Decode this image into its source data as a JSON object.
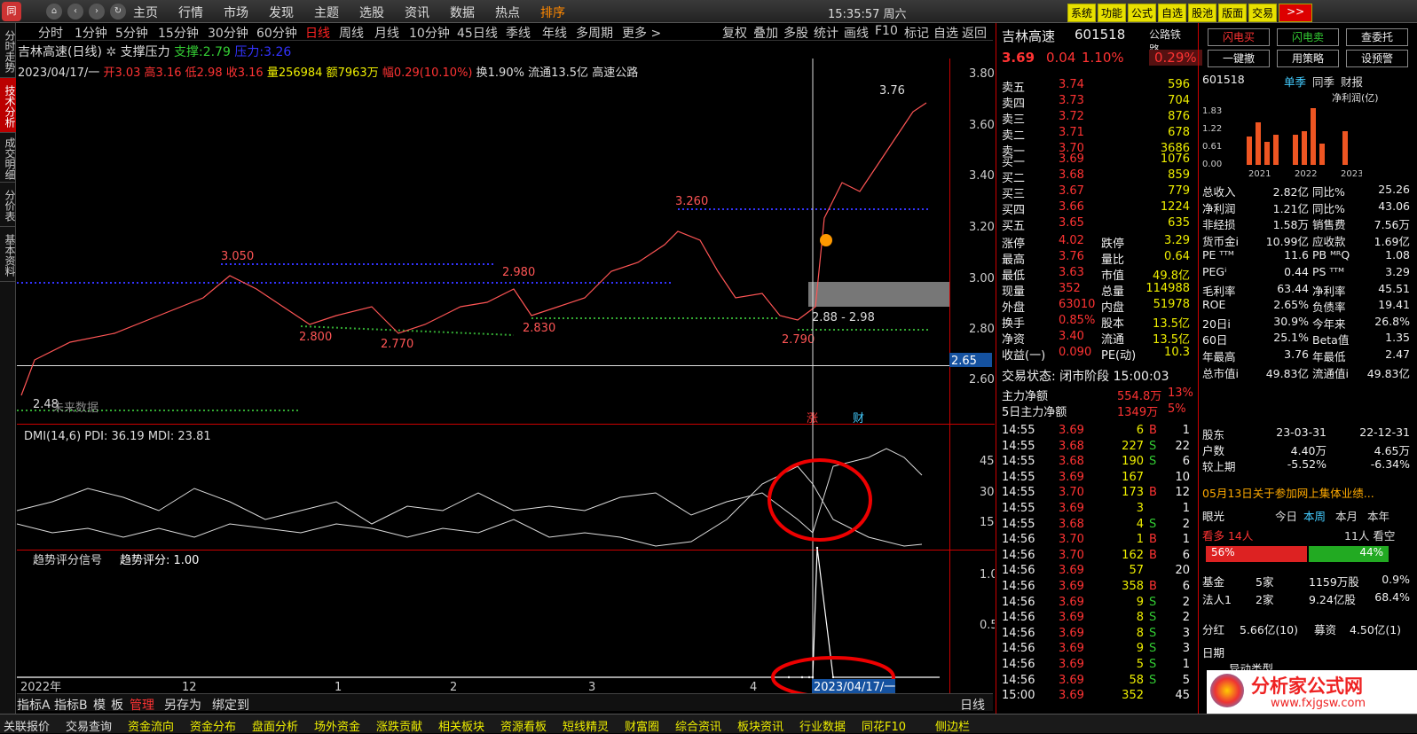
{
  "menu": {
    "items": [
      "主页",
      "行情",
      "市场",
      "发现",
      "主题",
      "选股",
      "资讯",
      "数据",
      "热点",
      "排序"
    ],
    "clock": "15:35:57 周六",
    "right_buttons": [
      "系统",
      "功能",
      "公式",
      "自选",
      "股池",
      "版面",
      "交易",
      ">>"
    ]
  },
  "left_tabs": [
    "分时走势",
    "技术分析",
    "成交明细",
    "分价表",
    "基本资料"
  ],
  "period_tabs": [
    "分时",
    "1分钟",
    "5分钟",
    "15分钟",
    "30分钟",
    "60分钟",
    "日线",
    "周线",
    "月线",
    "10分钟",
    "45日线",
    "季线",
    "年线",
    "多周期",
    "更多 >"
  ],
  "period_right": [
    "复权",
    "叠加",
    "多股",
    "统计",
    "画线",
    "F10",
    "标记",
    "自选",
    "返回"
  ],
  "chart": {
    "title": "吉林高速(日线)",
    "indicator": "支撑压力",
    "support_label": "支撑:",
    "support": "2.79",
    "pressure_label": "压力:",
    "pressure": "3.26",
    "info_date": "2023/04/17/一",
    "info_open": "开3.03",
    "info_high": "高3.16",
    "info_low": "低2.98",
    "info_close": "收3.16",
    "info_vol": "量256984",
    "info_amt": "额7963万",
    "info_chg": "幅0.29(10.10%)",
    "info_turn": "换1.90%",
    "info_float": "流通13.5亿",
    "info_ind": "高速公路",
    "price_ticks": [
      "3.80",
      "3.60",
      "3.40",
      "3.20",
      "3.00",
      "2.80",
      "2.60"
    ],
    "annotations": [
      "3.76",
      "3.260",
      "3.050",
      "2.980",
      "2.800",
      "2.770",
      "2.830",
      "2.790",
      "2.48",
      "2.88 - 2.98"
    ],
    "current_price": "2.65",
    "no_data_label": "未来数据",
    "markers": [
      "涨",
      "财"
    ],
    "dmi_title": "DMI(14,6) PDI: 36.19 MDI: 23.81",
    "dmi_ticks": [
      "45.00",
      "30.00",
      "15.00"
    ],
    "trend_title": "趋势评分信号",
    "trend_score": "趋势评分: 1.00",
    "trend_ticks": [
      "1.00",
      "0.50"
    ],
    "x_labels": [
      "2022年",
      "12",
      "1",
      "2",
      "3",
      "4"
    ],
    "cursor_date": "2023/04/17/一",
    "period_label": "日线"
  },
  "chart_data": {
    "type": "line",
    "series": [
      {
        "name": "趋势评分",
        "values": [
          0,
          0,
          0,
          0,
          1,
          0
        ]
      }
    ],
    "ylim": [
      0,
      1
    ]
  },
  "quote": {
    "name": "吉林高速",
    "code": "601518",
    "sector": "公路铁路",
    "price": "3.69",
    "chg": "0.04",
    "pct": "1.10%",
    "sector_pct": "0.29%",
    "asks": [
      [
        "卖五",
        "3.74",
        "596"
      ],
      [
        "卖四",
        "3.73",
        "704"
      ],
      [
        "卖三",
        "3.72",
        "876"
      ],
      [
        "卖二",
        "3.71",
        "678"
      ],
      [
        "卖一",
        "3.70",
        "3686"
      ]
    ],
    "bids": [
      [
        "买一",
        "3.69",
        "1076"
      ],
      [
        "买二",
        "3.68",
        "859"
      ],
      [
        "买三",
        "3.67",
        "779"
      ],
      [
        "买四",
        "3.66",
        "1224"
      ],
      [
        "买五",
        "3.65",
        "635"
      ]
    ],
    "stats": [
      [
        "涨停",
        "4.02",
        "跌停",
        "3.29"
      ],
      [
        "最高",
        "3.76",
        "量比",
        "0.64"
      ],
      [
        "最低",
        "3.63",
        "市值",
        "49.8亿"
      ],
      [
        "现量",
        "352",
        "总量",
        "114988"
      ],
      [
        "外盘",
        "63010",
        "内盘",
        "51978"
      ],
      [
        "换手",
        "0.85%",
        "股本",
        "13.5亿"
      ],
      [
        "净资",
        "3.40",
        "流通",
        "13.5亿"
      ],
      [
        "收益(一)",
        "0.090",
        "PE(动)",
        "10.3"
      ]
    ],
    "status": "交易状态: 闭市阶段 15:00:03",
    "flow": [
      [
        "主力净额",
        "554.8万",
        "13%"
      ],
      [
        "5日主力净额",
        "1349万",
        "5%"
      ]
    ],
    "ticks": [
      [
        "14:55",
        "3.69",
        "6",
        "B",
        "1"
      ],
      [
        "14:55",
        "3.68",
        "227",
        "S",
        "22"
      ],
      [
        "14:55",
        "3.68",
        "190",
        "S",
        "6"
      ],
      [
        "14:55",
        "3.69",
        "167",
        "",
        "10"
      ],
      [
        "14:55",
        "3.70",
        "173",
        "B",
        "12"
      ],
      [
        "14:55",
        "3.69",
        "3",
        "",
        "1"
      ],
      [
        "14:55",
        "3.68",
        "4",
        "S",
        "2"
      ],
      [
        "14:56",
        "3.70",
        "1",
        "B",
        "1"
      ],
      [
        "14:56",
        "3.70",
        "162",
        "B",
        "6"
      ],
      [
        "14:56",
        "3.69",
        "57",
        "",
        "20"
      ],
      [
        "14:56",
        "3.69",
        "358",
        "B",
        "6"
      ],
      [
        "14:56",
        "3.69",
        "9",
        "S",
        "2"
      ],
      [
        "14:56",
        "3.69",
        "8",
        "S",
        "2"
      ],
      [
        "14:56",
        "3.69",
        "8",
        "S",
        "3"
      ],
      [
        "14:56",
        "3.69",
        "9",
        "S",
        "3"
      ],
      [
        "14:56",
        "3.69",
        "5",
        "S",
        "1"
      ],
      [
        "14:56",
        "3.69",
        "58",
        "S",
        "5"
      ],
      [
        "15:00",
        "3.69",
        "352",
        "",
        "45"
      ]
    ]
  },
  "right": {
    "buttons": [
      "闪电买",
      "闪电卖",
      "查委托",
      "一键撤",
      "用策略",
      "设预警"
    ],
    "code": "601518",
    "tabs": [
      "单季",
      "同季",
      "财报"
    ],
    "metric": "净利润(亿)",
    "bar_ticks": [
      "1.83",
      "1.22",
      "0.61",
      "0.00"
    ],
    "years": [
      "2021",
      "2022",
      "2023"
    ],
    "fin": [
      [
        "总收入",
        "2.82亿",
        "同比%",
        "25.26"
      ],
      [
        "净利润",
        "1.21亿",
        "同比%",
        "43.06"
      ],
      [
        "非经损",
        "1.58万",
        "销售费",
        "7.56万"
      ],
      [
        "货币金i",
        "10.99亿",
        "应收款",
        "1.69亿"
      ],
      [
        "PE ᵀᵀᴹ",
        "11.6",
        "PB ᴹᴿQ",
        "1.08"
      ],
      [
        "PEGⁱ",
        "0.44",
        "PS ᵀᵀᴹ",
        "3.29"
      ],
      [
        "毛利率",
        "63.44",
        "净利率",
        "45.51"
      ],
      [
        "ROE",
        "2.65%",
        "负债率",
        "19.41"
      ],
      [
        "20日i",
        "30.9%",
        "今年来",
        "26.8%"
      ],
      [
        "60日",
        "25.1%",
        "Beta值",
        "1.35"
      ],
      [
        "年最高",
        "3.76",
        "年最低",
        "2.47"
      ],
      [
        "总市值i",
        "49.83亿",
        "流通值i",
        "49.83亿"
      ]
    ],
    "holders": [
      [
        "股东",
        "23-03-31",
        "22-12-31"
      ],
      [
        "户数",
        "4.40万",
        "4.65万"
      ],
      [
        "较上期",
        "-5.52%",
        "-6.34%"
      ]
    ],
    "news": "05月13日关于参加网上集体业绩...",
    "eye_title": "眼光",
    "eye_tabs": [
      "今日",
      "本周",
      "本月",
      "本年"
    ],
    "bull": "看多 14人",
    "bear": "11人 看空",
    "bull_pct": "56%",
    "bear_pct": "44%",
    "inst": [
      [
        "基金",
        "5家",
        "1159万股",
        "0.9%"
      ],
      [
        "法人1",
        "2家",
        "9.24亿股",
        "68.4%"
      ]
    ],
    "div": [
      "分红",
      "5.66亿(10)",
      "募资",
      "4.50亿(1)"
    ],
    "date_label": "日期",
    "abn": "异动类型",
    "watermark": "分析家公式网",
    "watermark_url": "www.fxjgsw.com"
  },
  "bottom_tabs": [
    "指标A",
    "指标B",
    "模",
    "板",
    "管理",
    "另存为",
    "绑定到"
  ],
  "footer": [
    "关联报价",
    "交易查询",
    "资金流向",
    "资金分布",
    "盘面分析",
    "场外资金",
    "涨跌贡献",
    "相关板块",
    "资源看板",
    "短线精灵",
    "财富圈",
    "综合资讯",
    "板块资讯",
    "行业数据",
    "同花F10",
    "侧边栏"
  ]
}
